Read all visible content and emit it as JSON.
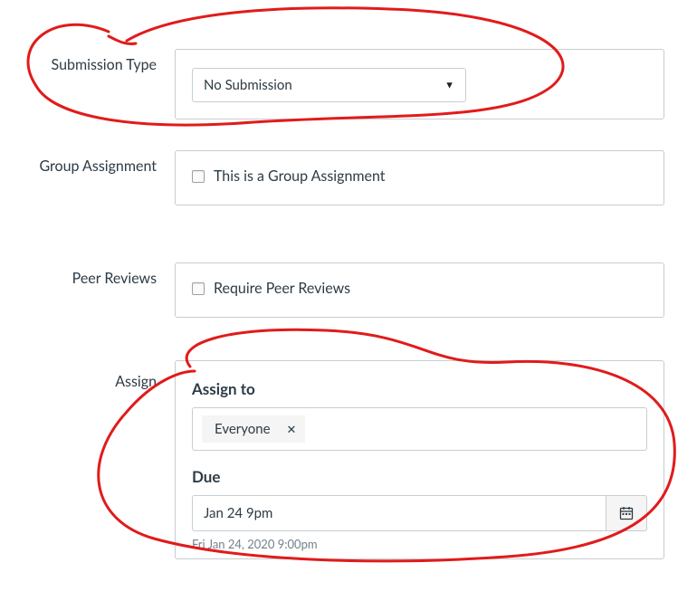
{
  "submissionType": {
    "label": "Submission Type",
    "selected": "No Submission"
  },
  "groupAssignment": {
    "label": "Group Assignment",
    "checkboxLabel": "This is a Group Assignment"
  },
  "peerReviews": {
    "label": "Peer Reviews",
    "checkboxLabel": "Require Peer Reviews"
  },
  "assign": {
    "label": "Assign",
    "assignToHeading": "Assign to",
    "assignee": "Everyone",
    "dueHeading": "Due",
    "dueValue": "Jan 24 9pm",
    "dueHint": "Fri Jan 24, 2020 9:00pm"
  }
}
